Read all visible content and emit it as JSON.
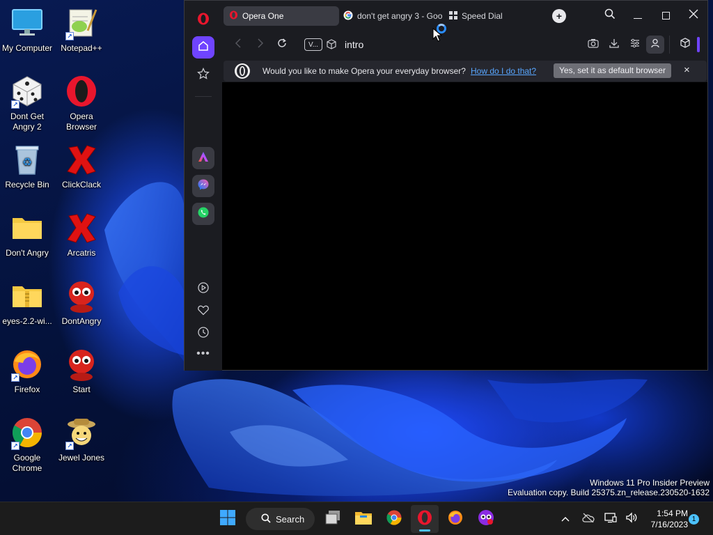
{
  "desktop": {
    "icons": [
      {
        "label": "My Computer",
        "icon": "monitor-icon"
      },
      {
        "label": "Notepad++",
        "icon": "notepadpp-icon"
      },
      {
        "label": "Dont Get Angry 2",
        "icon": "dice-icon"
      },
      {
        "label": "Opera Browser",
        "icon": "opera-icon"
      },
      {
        "label": "Recycle Bin",
        "icon": "recycle-bin-icon"
      },
      {
        "label": "ClickClack",
        "icon": "red-x-icon"
      },
      {
        "label": "Don't Angry",
        "icon": "folder-icon"
      },
      {
        "label": "Arcatris",
        "icon": "red-x-icon"
      },
      {
        "label": "eyes-2.2-wi...",
        "icon": "zip-folder-icon"
      },
      {
        "label": "DontAngry",
        "icon": "red-figure-icon"
      },
      {
        "label": "Firefox",
        "icon": "firefox-icon"
      },
      {
        "label": "Start",
        "icon": "red-figure-icon"
      },
      {
        "label": "Google Chrome",
        "icon": "chrome-icon"
      },
      {
        "label": "Jewel Jones",
        "icon": "jewel-jones-icon"
      }
    ]
  },
  "browser": {
    "tabs": [
      {
        "label": "Opera One",
        "icon": "opera-icon",
        "active": true
      },
      {
        "label": "don't get angry 3 - Goo",
        "icon": "google-icon",
        "active": false
      },
      {
        "label": "Speed Dial",
        "icon": "grid-icon",
        "active": false
      }
    ],
    "address": {
      "badge": "V...",
      "value": "intro"
    },
    "infobar": {
      "message": "Would you like to make Opera your everyday browser?",
      "link": "How do I do that?",
      "button": "Yes, set it as default browser",
      "close": "×"
    },
    "sidebar": [
      "home-icon",
      "bookmarks-icon",
      "aria-icon",
      "messenger-icon",
      "whatsapp-icon",
      "player-icon",
      "heart-icon",
      "history-icon",
      "more-icon"
    ]
  },
  "taskbar": {
    "search_label": "Search",
    "time": "1:54 PM",
    "date": "7/16/2023",
    "notification_count": "1"
  },
  "watermark": {
    "line1": "Windows 11 Pro Insider Preview",
    "line2": "Evaluation copy. Build 25375.zn_release.230520-1632"
  },
  "colors": {
    "opera_red": "#e8162d",
    "accent_purple": "#6f44ff",
    "link_blue": "#58a6ff"
  }
}
